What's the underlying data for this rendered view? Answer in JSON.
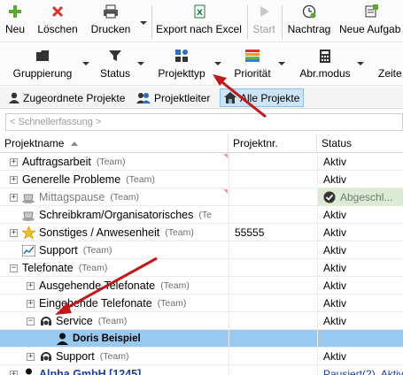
{
  "toolbar1": {
    "neu": "Neu",
    "loeschen": "Löschen",
    "drucken": "Drucken",
    "export": "Export nach Excel",
    "start": "Start",
    "nachtrag": "Nachtrag",
    "neue_aufgabe": "Neue Aufgab"
  },
  "toolbar2": {
    "gruppierung": "Gruppierung",
    "status": "Status",
    "projekttyp": "Projekttyp",
    "prioritaet": "Priorität",
    "abrmodus": "Abr.modus",
    "zeit": "Zeite"
  },
  "tabs": [
    {
      "label": "Zugeordnete Projekte"
    },
    {
      "label": "Projektleiter"
    },
    {
      "label": "Alle Projekte"
    }
  ],
  "quick": {
    "placeholder": "< Schnellerfassung >"
  },
  "columns": {
    "name": "Projektname",
    "nr": "Projektnr.",
    "status": "Status"
  },
  "rows": [
    {
      "name": "Auftragsarbeit",
      "team": "(Team)",
      "nr": "",
      "status": "Aktiv"
    },
    {
      "name": "Generelle Probleme",
      "team": "(Team)",
      "nr": "",
      "status": "Aktiv"
    },
    {
      "name": "Mittagspause",
      "team": "(Team)",
      "nr": "",
      "status": "Abgeschl..."
    },
    {
      "name": "Schreibkram/Organisatorisches",
      "team": "(Te",
      "nr": "",
      "status": "Aktiv"
    },
    {
      "name": "Sonstiges / Anwesenheit",
      "team": "(Team)",
      "nr": "55555",
      "status": "Aktiv"
    },
    {
      "name": "Support",
      "team": "(Team)",
      "nr": "",
      "status": "Aktiv"
    },
    {
      "name": "Telefonate",
      "team": "(Team)",
      "nr": "",
      "status": "Aktiv"
    },
    {
      "name": "Ausgehende Telefonate",
      "team": "(Team)",
      "nr": "",
      "status": "Aktiv"
    },
    {
      "name": "Eingehende Telefonate",
      "team": "(Team)",
      "nr": "",
      "status": "Aktiv"
    },
    {
      "name": "Service",
      "team": "(Team)",
      "nr": "",
      "status": "Aktiv"
    },
    {
      "name": "Doris Beispiel",
      "team": "",
      "nr": "",
      "status": ""
    },
    {
      "name": "Support",
      "team": "(Team)",
      "nr": "",
      "status": "Aktiv"
    },
    {
      "name": "Alpha GmbH [1245]",
      "team": "",
      "nr": "",
      "status": "Pausiert(2), Aktiv"
    }
  ],
  "colors": {
    "accent": "#99c9ef",
    "link": "#1f3aa0",
    "annotation_arrow": "#c0191c",
    "done": "#dcebd5"
  }
}
